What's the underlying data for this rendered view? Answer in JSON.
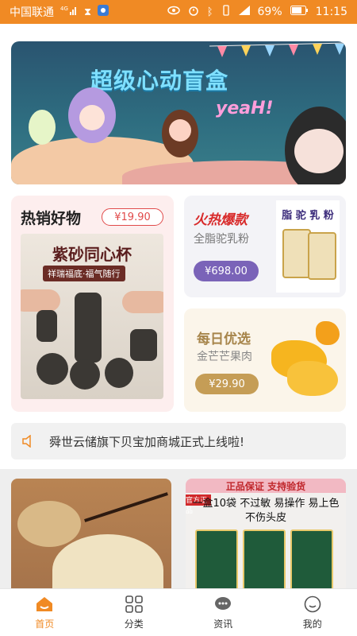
{
  "status_bar": {
    "carrier": "中国联通",
    "signal": "4G",
    "battery": "69%",
    "time": "11:15"
  },
  "banner": {
    "title": "超级心动盲盒",
    "tag": "yeaH!"
  },
  "hot_card": {
    "heading": "热销好物",
    "price": "¥19.90",
    "product_title": "紫砂同心杯",
    "product_tagline": "祥瑞福底·福气随行"
  },
  "milk_card": {
    "heading": "火热爆款",
    "subtitle": "全脂驼乳粉",
    "price": "¥698.00",
    "image_label": "脂 驼 乳 粉"
  },
  "mango_card": {
    "heading": "每日优选",
    "subtitle": "金芒芒果肉",
    "price": "¥29.90"
  },
  "notice": {
    "text": "舜世云储旗下贝宝加商城正式上线啦!"
  },
  "product2": {
    "banner": "正品保证 支持验货",
    "line1": "一盒10袋 不过敏 易操作 易上色",
    "line2": "不伤头皮",
    "tag": "官方正品"
  },
  "tabbar": {
    "items": [
      {
        "label": "首页",
        "icon": "home-icon"
      },
      {
        "label": "分类",
        "icon": "grid-icon"
      },
      {
        "label": "资讯",
        "icon": "chat-icon"
      },
      {
        "label": "我的",
        "icon": "user-icon"
      }
    ],
    "active_index": 0
  },
  "colors": {
    "accent": "#f08a24",
    "price_red": "#e14b4b",
    "milk_purple": "#7a63b8",
    "mango_gold": "#c59d56"
  }
}
